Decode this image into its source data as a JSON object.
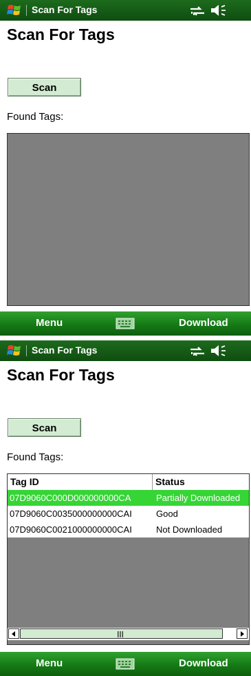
{
  "screens": [
    {
      "title_bar": {
        "app_title": "Scan For Tags",
        "icons": [
          "windows-logo-icon",
          "connectivity-icon",
          "volume-icon"
        ]
      },
      "page_title": "Scan For Tags",
      "scan_button_label": "Scan",
      "found_tags_label": "Found Tags:",
      "softkeys": {
        "left": "Menu",
        "right": "Download",
        "center_icon": "keyboard-icon"
      }
    },
    {
      "title_bar": {
        "app_title": "Scan For Tags",
        "icons": [
          "windows-logo-icon",
          "connectivity-icon",
          "volume-icon"
        ]
      },
      "page_title": "Scan For Tags",
      "scan_button_label": "Scan",
      "found_tags_label": "Found Tags:",
      "table": {
        "columns": [
          "Tag ID",
          "Status"
        ],
        "rows": [
          {
            "tag_id": "07D9060C000D000000000CA",
            "status": "Partially Downloaded",
            "selected": true
          },
          {
            "tag_id": "07D9060C0035000000000CAI",
            "status": "Good",
            "selected": false
          },
          {
            "tag_id": "07D9060C0021000000000CAI",
            "status": "Not Downloaded",
            "selected": false
          }
        ]
      },
      "softkeys": {
        "left": "Menu",
        "right": "Download",
        "center_icon": "keyboard-icon"
      }
    }
  ],
  "colors": {
    "titlebar": "#155b15",
    "softkey_bar": "#1b861b",
    "button_fill": "#d2ebd2",
    "list_background": "#7f7f7f",
    "selected_row": "#36d536"
  }
}
